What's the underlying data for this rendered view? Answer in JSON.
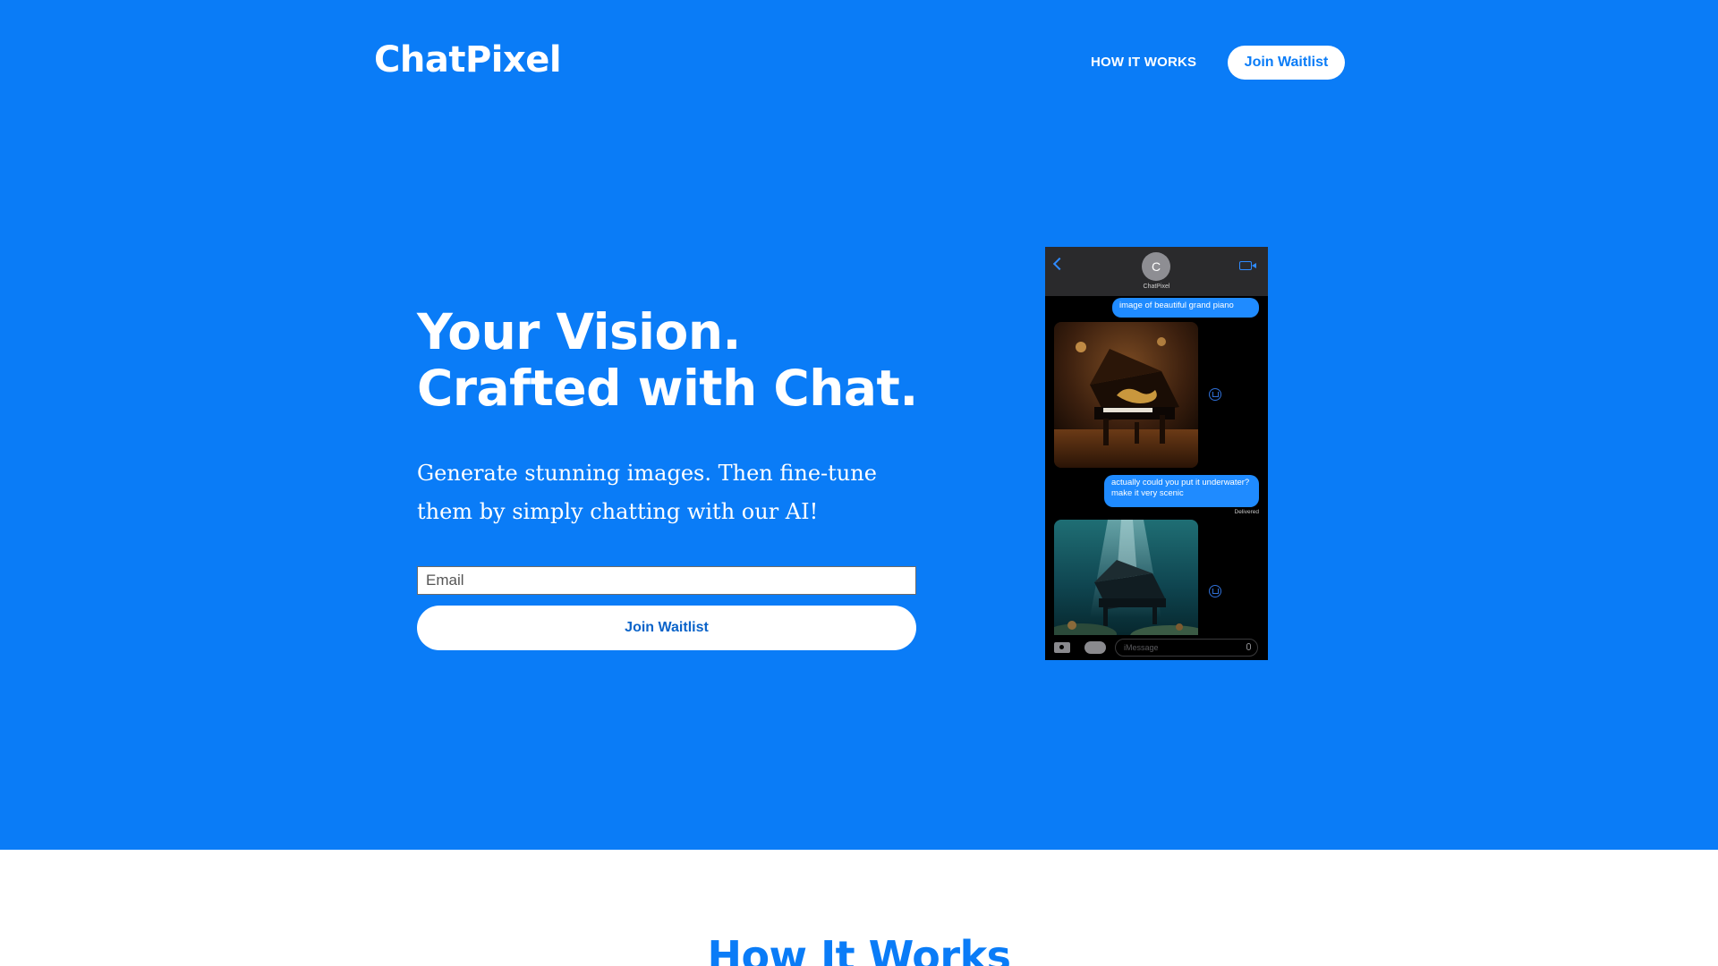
{
  "brand": {
    "name": "ChatPixel"
  },
  "nav": {
    "how_it_works": "HOW IT WORKS",
    "join_waitlist": "Join Waitlist"
  },
  "hero": {
    "headline_line1": "Your Vision.",
    "headline_line2": "Crafted with Chat.",
    "subtext": "Generate stunning images. Then fine-tune them by simply chatting with our AI!",
    "email_placeholder": "Email",
    "cta_label": "Join Waitlist"
  },
  "phone": {
    "avatar_initial": "C",
    "contact_name": "ChatPixel",
    "messages": [
      {
        "text": "image of beautiful grand piano"
      },
      {
        "text": "actually could you put it underwater? make it very scenic"
      }
    ],
    "delivered": "Delivered",
    "input_placeholder": "iMessage",
    "images": [
      "grand-piano-image",
      "underwater-piano-image"
    ]
  },
  "how_it_works": {
    "title": "How It Works"
  },
  "colors": {
    "brand_blue": "#0a7cf7",
    "imessage_blue": "#1f8bff",
    "white": "#ffffff"
  },
  "icons": [
    "back-icon",
    "video-icon",
    "save-icon",
    "camera-icon",
    "apps-icon",
    "mic-icon"
  ]
}
